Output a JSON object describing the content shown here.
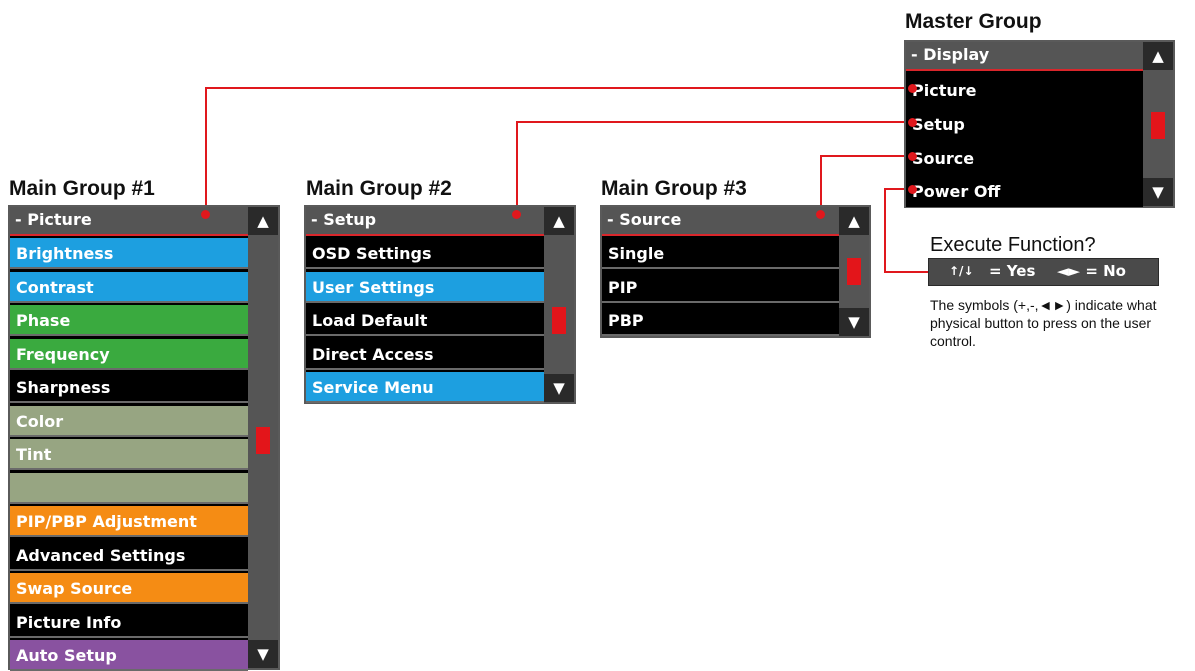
{
  "colors": {
    "connector": "#e0181d",
    "header_bg": "#555555",
    "header_underline": "#d9262b",
    "scrollbar": "#555555",
    "scroll_thumb": "#e3151a",
    "blue": "#1d9fe0",
    "green": "#3aaa3f",
    "gray": "#97a582",
    "orange": "#f58c14",
    "purple": "#8952a0"
  },
  "scroll": {
    "up_icon": "▲",
    "down_icon": "▼"
  },
  "master": {
    "title": "Master Group",
    "header": "- Display",
    "items": [
      "Picture",
      "Setup",
      "Source",
      "Power Off"
    ]
  },
  "group1": {
    "title": "Main Group #1",
    "header": "- Picture",
    "items": [
      {
        "label": "Brightness",
        "color": "blue"
      },
      {
        "label": "Contrast",
        "color": "blue"
      },
      {
        "label": "Phase",
        "color": "green"
      },
      {
        "label": "Frequency",
        "color": "green"
      },
      {
        "label": "Sharpness",
        "color": "black"
      },
      {
        "label": "Color",
        "color": "gray"
      },
      {
        "label": "Tint",
        "color": "gray"
      },
      {
        "label": "",
        "color": "gray"
      },
      {
        "label": "PIP/PBP Adjustment",
        "color": "orange"
      },
      {
        "label": "Advanced Settings",
        "color": "black"
      },
      {
        "label": "Swap Source",
        "color": "orange"
      },
      {
        "label": "Picture Info",
        "color": "black"
      },
      {
        "label": "Auto Setup",
        "color": "purple"
      }
    ]
  },
  "group2": {
    "title": "Main Group #2",
    "header": "- Setup",
    "items": [
      {
        "label": "OSD Settings",
        "color": "black"
      },
      {
        "label": "User Settings",
        "color": "blue"
      },
      {
        "label": "Load Default",
        "color": "black"
      },
      {
        "label": "Direct Access",
        "color": "black"
      },
      {
        "label": "Service Menu",
        "color": "blue"
      }
    ]
  },
  "group3": {
    "title": "Main Group #3",
    "header": "- Source",
    "items": [
      {
        "label": "Single",
        "color": "black"
      },
      {
        "label": "PIP",
        "color": "black"
      },
      {
        "label": "PBP",
        "color": "black"
      }
    ]
  },
  "execute": {
    "title": "Execute Function?",
    "symbols": "↑/↓",
    "yes": "= Yes",
    "no_symbol": "◄►",
    "no": "= No",
    "note": "The symbols (+,-,◄►) indicate what physical button to press on the user control."
  }
}
